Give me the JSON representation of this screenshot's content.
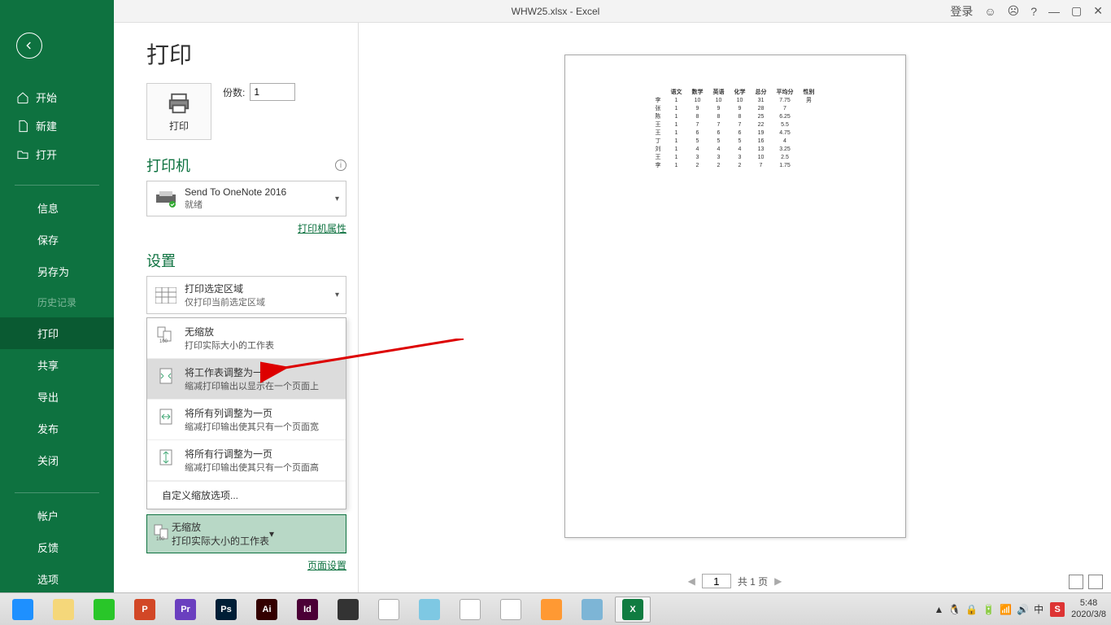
{
  "titlebar": {
    "title": "WHW25.xlsx  -  Excel",
    "login": "登录",
    "face_smile": "☺",
    "face_sad": "☹",
    "help": "?",
    "min": "—",
    "max": "▢",
    "close": "✕"
  },
  "sidebar": {
    "home": "开始",
    "new": "新建",
    "open": "打开",
    "info": "信息",
    "save": "保存",
    "saveas": "另存为",
    "history": "历史记录",
    "print": "打印",
    "share": "共享",
    "export": "导出",
    "publish": "发布",
    "close": "关闭",
    "account": "帐户",
    "feedback": "反馈",
    "options": "选项"
  },
  "print": {
    "title": "打印",
    "button_label": "打印",
    "copies_label": "份数:",
    "copies_value": "1",
    "printer_head": "打印机",
    "printer_name": "Send To OneNote 2016",
    "printer_status": "就绪",
    "printer_props": "打印机属性",
    "settings_head": "设置",
    "area_title": "打印选定区域",
    "area_sub": "仅打印当前选定区域",
    "scaling": {
      "opt1_title": "无缩放",
      "opt1_sub": "打印实际大小的工作表",
      "opt2_title": "将工作表调整为一页",
      "opt2_sub": "缩减打印输出以显示在一个页面上",
      "opt3_title": "将所有列调整为一页",
      "opt3_sub": "缩减打印输出使其只有一个页面宽",
      "opt4_title": "将所有行调整为一页",
      "opt4_sub": "缩减打印输出使其只有一个页面高",
      "custom": "自定义缩放选项...",
      "selected_title": "无缩放",
      "selected_sub": "打印实际大小的工作表"
    },
    "page_setup": "页面设置"
  },
  "nav": {
    "page_input": "1",
    "of_text": "共 1 页"
  },
  "chart_data": {
    "type": "table",
    "headers": [
      "",
      "语文",
      "数学",
      "英语",
      "化学",
      "总分",
      "平均分",
      "性别"
    ],
    "rows": [
      [
        "李",
        "1",
        "10",
        "10",
        "10",
        "31",
        "7.75",
        "男"
      ],
      [
        "张",
        "1",
        "9",
        "9",
        "9",
        "28",
        "7",
        ""
      ],
      [
        "陈",
        "1",
        "8",
        "8",
        "8",
        "25",
        "6.25",
        ""
      ],
      [
        "王",
        "1",
        "7",
        "7",
        "7",
        "22",
        "5.5",
        ""
      ],
      [
        "王",
        "1",
        "6",
        "6",
        "6",
        "19",
        "4.75",
        ""
      ],
      [
        "丁",
        "1",
        "5",
        "5",
        "5",
        "16",
        "4",
        ""
      ],
      [
        "刘",
        "1",
        "4",
        "4",
        "4",
        "13",
        "3.25",
        ""
      ],
      [
        "王",
        "1",
        "3",
        "3",
        "3",
        "10",
        "2.5",
        ""
      ],
      [
        "李",
        "1",
        "2",
        "2",
        "2",
        "7",
        "1.75",
        ""
      ]
    ]
  },
  "taskbar": {
    "icons": [
      {
        "bg": "#1e90ff",
        "label": ""
      },
      {
        "bg": "#f5d77a",
        "label": ""
      },
      {
        "bg": "#29c629",
        "label": ""
      },
      {
        "bg": "#d24726",
        "label": "P"
      },
      {
        "bg": "#6a3fbf",
        "label": "Pr"
      },
      {
        "bg": "#001e36",
        "label": "Ps"
      },
      {
        "bg": "#330000",
        "label": "Ai"
      },
      {
        "bg": "#4b0036",
        "label": "Id"
      },
      {
        "bg": "#333333",
        "label": ""
      },
      {
        "bg": "#ffffff",
        "label": "",
        "border": "#aaa"
      },
      {
        "bg": "#7ec8e3",
        "label": ""
      },
      {
        "bg": "#ffffff",
        "label": "",
        "border": "#aaa"
      },
      {
        "bg": "#ffffff",
        "label": "",
        "border": "#aaa"
      },
      {
        "bg": "#ff9933",
        "label": ""
      },
      {
        "bg": "#7db5d6",
        "label": ""
      },
      {
        "bg": "#107c41",
        "label": "X",
        "active": true
      }
    ],
    "tray": [
      "▲",
      "🐧",
      "🔒",
      "🔋",
      "📶",
      "🔊",
      "中"
    ],
    "ime": "S",
    "time": "5:48",
    "date": "2020/3/8"
  }
}
